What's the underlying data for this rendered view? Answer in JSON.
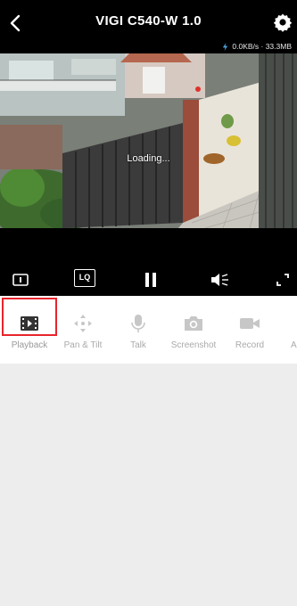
{
  "header": {
    "title": "VIGI C540-W 1.0",
    "data_rate": "0.0KB/s · 33.3MB"
  },
  "video": {
    "status_text": "Loading..."
  },
  "controls": {
    "quality_label": "LQ"
  },
  "toolbar": {
    "items": [
      {
        "label": "Playback",
        "icon": "film-icon",
        "selected": true
      },
      {
        "label": "Pan & Tilt",
        "icon": "pan-tilt-icon"
      },
      {
        "label": "Talk",
        "icon": "microphone-icon"
      },
      {
        "label": "Screenshot",
        "icon": "camera-icon"
      },
      {
        "label": "Record",
        "icon": "video-camera-icon"
      },
      {
        "label": "A",
        "icon": "truncated-icon"
      }
    ]
  },
  "colors": {
    "topbar": "#000000",
    "toolbar_bg": "#ffffff",
    "highlight": "#e8242c",
    "icon_gray": "#c2c2c2"
  }
}
